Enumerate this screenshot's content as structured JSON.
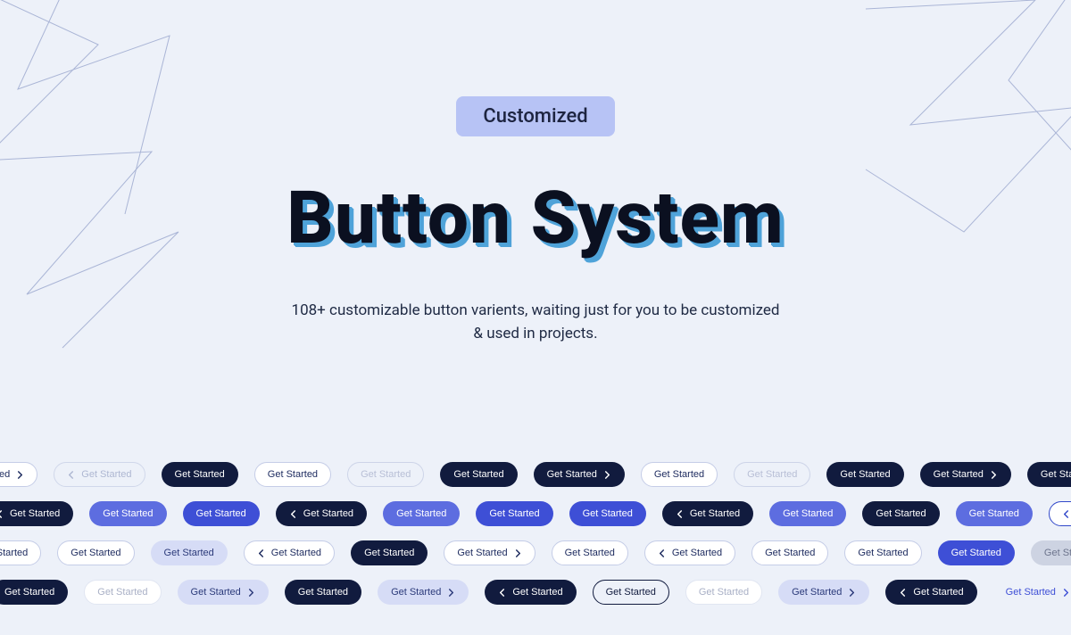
{
  "hero": {
    "pill": "Customized",
    "title": "Button System",
    "subtitle": "108+ customizable button varients, waiting just for you to be customized & used in projects."
  },
  "btn_label": "Get Started",
  "rows": [
    [
      {
        "v": "v-white",
        "icon": "right"
      },
      {
        "v": "v-ghost",
        "icon": "left"
      },
      {
        "v": "v-navy",
        "icon": null
      },
      {
        "v": "v-white",
        "icon": null
      },
      {
        "v": "v-ghost-2",
        "icon": null
      },
      {
        "v": "v-navy",
        "icon": null
      },
      {
        "v": "v-navy",
        "icon": "right"
      },
      {
        "v": "v-white",
        "icon": null
      },
      {
        "v": "v-ghost-2",
        "icon": null
      },
      {
        "v": "v-navy",
        "icon": null
      },
      {
        "v": "v-navy",
        "icon": "right"
      },
      {
        "v": "v-navy",
        "icon": null
      }
    ],
    [
      {
        "v": "v-navy",
        "icon": "left"
      },
      {
        "v": "v-indigo-soft",
        "icon": null
      },
      {
        "v": "v-indigo",
        "icon": null
      },
      {
        "v": "v-navy",
        "icon": "left"
      },
      {
        "v": "v-indigo-soft",
        "icon": null
      },
      {
        "v": "v-indigo",
        "icon": null
      },
      {
        "v": "v-indigo",
        "icon": null
      },
      {
        "v": "v-navy",
        "icon": "left"
      },
      {
        "v": "v-indigo-soft",
        "icon": null
      },
      {
        "v": "v-navy",
        "icon": null
      },
      {
        "v": "v-indigo-soft",
        "icon": null
      },
      {
        "v": "v-blue-outline",
        "icon": "left"
      }
    ],
    [
      {
        "v": "v-white",
        "icon": null
      },
      {
        "v": "v-white",
        "icon": null
      },
      {
        "v": "v-blue-soft",
        "icon": null
      },
      {
        "v": "v-white",
        "icon": "left"
      },
      {
        "v": "v-navy",
        "icon": null
      },
      {
        "v": "v-white",
        "icon": "right"
      },
      {
        "v": "v-white",
        "icon": null
      },
      {
        "v": "v-white",
        "icon": "left"
      },
      {
        "v": "v-white",
        "icon": null
      },
      {
        "v": "v-white",
        "icon": null
      },
      {
        "v": "v-indigo",
        "icon": null
      },
      {
        "v": "v-gray-soft",
        "icon": null
      }
    ],
    [
      {
        "v": "v-navy",
        "icon": null
      },
      {
        "v": "v-white-soft",
        "icon": null
      },
      {
        "v": "v-blue-soft",
        "icon": "right"
      },
      {
        "v": "v-navy",
        "icon": null
      },
      {
        "v": "v-blue-soft",
        "icon": "right"
      },
      {
        "v": "v-navy",
        "icon": "left"
      },
      {
        "v": "v-dark-outline",
        "icon": null
      },
      {
        "v": "v-white-soft",
        "icon": null
      },
      {
        "v": "v-blue-soft",
        "icon": "right"
      },
      {
        "v": "v-navy",
        "icon": "left"
      },
      {
        "v": "v-text",
        "icon": "right"
      }
    ]
  ]
}
